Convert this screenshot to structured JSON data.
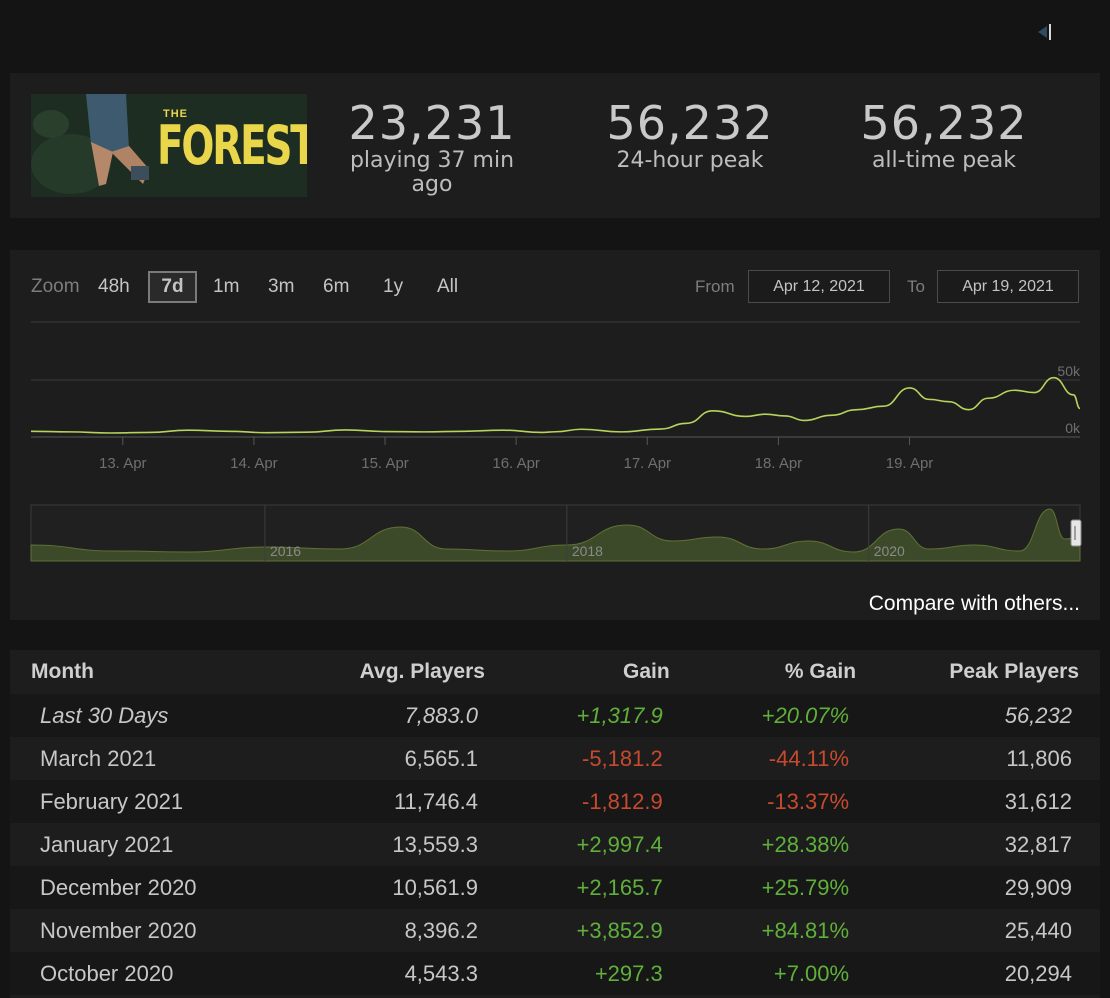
{
  "header": {
    "logo_top": "THE",
    "logo_main": "FOREST",
    "stats": [
      {
        "value": "23,231",
        "label": "playing 37 min ago"
      },
      {
        "value": "56,232",
        "label": "24-hour peak"
      },
      {
        "value": "56,232",
        "label": "all-time peak"
      }
    ]
  },
  "controls": {
    "zoom_label": "Zoom",
    "zoom_options": [
      "48h",
      "7d",
      "1m",
      "3m",
      "6m",
      "1y",
      "All"
    ],
    "zoom_selected": "7d",
    "from_label": "From",
    "from_value": "Apr 12, 2021",
    "to_label": "To",
    "to_value": "Apr 19, 2021"
  },
  "chart_data": [
    {
      "type": "line",
      "x_tick_labels": [
        "13. Apr",
        "14. Apr",
        "15. Apr",
        "16. Apr",
        "17. Apr",
        "18. Apr",
        "19. Apr"
      ],
      "y_tick_labels": [
        "0k",
        "50k"
      ],
      "ylim": [
        0,
        50000
      ],
      "x_days": [
        0,
        0.3,
        0.6,
        0.9,
        1.2,
        1.5,
        1.8,
        2.1,
        2.4,
        2.7,
        3.0,
        3.3,
        3.6,
        3.9,
        4.0,
        4.2,
        4.5,
        4.8,
        5.0,
        5.2,
        5.45,
        5.6,
        5.75,
        5.9,
        6.1,
        6.3,
        6.5,
        6.7,
        6.85,
        7.0,
        7.15,
        7.3,
        7.5,
        7.65,
        7.8,
        7.95,
        8.0
      ],
      "values": [
        5000,
        4500,
        3500,
        4000,
        6000,
        5000,
        3800,
        4200,
        6200,
        4800,
        4500,
        5000,
        6000,
        4000,
        4600,
        6800,
        4500,
        7000,
        12000,
        23000,
        18000,
        20000,
        18500,
        14500,
        19000,
        24000,
        27000,
        43000,
        33000,
        31000,
        24000,
        34000,
        41000,
        39000,
        52000,
        37000,
        25000
      ],
      "line_color": "#b6d45c",
      "grid": true
    },
    {
      "type": "area",
      "x_tick_labels": [
        "2016",
        "2018",
        "2020"
      ],
      "x_years": [
        2014.45,
        2015.0,
        2015.5,
        2016.0,
        2016.5,
        2016.9,
        2017.2,
        2017.6,
        2018.0,
        2018.4,
        2018.7,
        2019.0,
        2019.3,
        2019.6,
        2019.9,
        2020.2,
        2020.4,
        2020.7,
        2021.0,
        2021.2,
        2021.3,
        2021.4
      ],
      "values": [
        8000,
        5000,
        4500,
        7000,
        6000,
        17000,
        6000,
        5000,
        8000,
        18000,
        10000,
        12000,
        6000,
        10000,
        4500,
        16000,
        6000,
        8000,
        5000,
        26000,
        11000,
        12000
      ],
      "fill_color": "#3d4a2a",
      "line_color": "#5f7233"
    }
  ],
  "compare_label": "Compare with others...",
  "table": {
    "headers": [
      "Month",
      "Avg. Players",
      "Gain",
      "% Gain",
      "Peak Players"
    ],
    "rows": [
      {
        "month": "Last 30 Days",
        "avg": "7,883.0",
        "gain": "+1,317.9",
        "pct": "+20.07%",
        "peak": "56,232"
      },
      {
        "month": "March 2021",
        "avg": "6,565.1",
        "gain": "-5,181.2",
        "pct": "-44.11%",
        "peak": "11,806"
      },
      {
        "month": "February 2021",
        "avg": "11,746.4",
        "gain": "-1,812.9",
        "pct": "-13.37%",
        "peak": "31,612"
      },
      {
        "month": "January 2021",
        "avg": "13,559.3",
        "gain": "+2,997.4",
        "pct": "+28.38%",
        "peak": "32,817"
      },
      {
        "month": "December 2020",
        "avg": "10,561.9",
        "gain": "+2,165.7",
        "pct": "+25.79%",
        "peak": "29,909"
      },
      {
        "month": "November 2020",
        "avg": "8,396.2",
        "gain": "+3,852.9",
        "pct": "+84.81%",
        "peak": "25,440"
      },
      {
        "month": "October 2020",
        "avg": "4,543.3",
        "gain": "+297.3",
        "pct": "+7.00%",
        "peak": "20,294"
      }
    ],
    "positive_color": "#5fb03a",
    "negative_color": "#c74a2e"
  }
}
